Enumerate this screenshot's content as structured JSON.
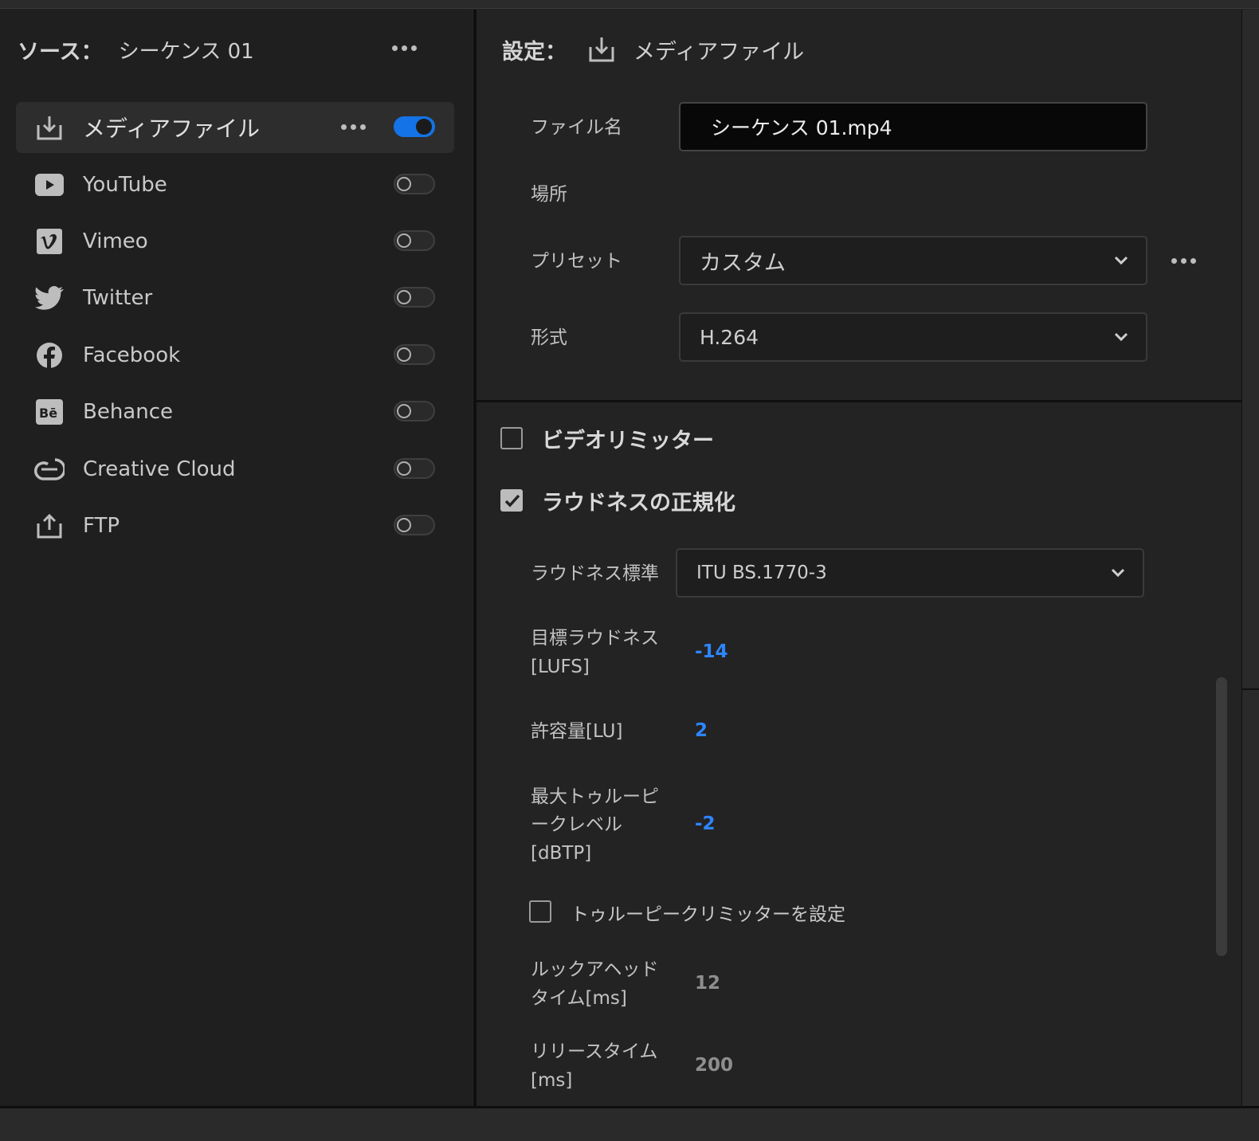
{
  "source": {
    "label": "ソース：",
    "sequence": "シーケンス 01"
  },
  "destinations": [
    {
      "label": "メディアファイル",
      "icon": "download-tray-icon",
      "active": true,
      "enabled": true
    },
    {
      "label": "YouTube",
      "icon": "youtube-icon",
      "active": false,
      "enabled": false
    },
    {
      "label": "Vimeo",
      "icon": "vimeo-icon",
      "active": false,
      "enabled": false
    },
    {
      "label": "Twitter",
      "icon": "twitter-icon",
      "active": false,
      "enabled": false
    },
    {
      "label": "Facebook",
      "icon": "facebook-icon",
      "active": false,
      "enabled": false
    },
    {
      "label": "Behance",
      "icon": "behance-icon",
      "active": false,
      "enabled": false
    },
    {
      "label": "Creative Cloud",
      "icon": "creative-cloud-icon",
      "active": false,
      "enabled": false
    },
    {
      "label": "FTP",
      "icon": "upload-tray-icon",
      "active": false,
      "enabled": false
    }
  ],
  "settings": {
    "label": "設定：",
    "target": "メディアファイル",
    "filename_label": "ファイル名",
    "filename_value": "シーケンス 01.mp4",
    "location_label": "場所",
    "preset_label": "プリセット",
    "preset_value": "カスタム",
    "format_label": "形式",
    "format_value": "H.264"
  },
  "video_limiter": {
    "label": "ビデオリミッター",
    "checked": false
  },
  "loudness": {
    "label": "ラウドネスの正規化",
    "checked": true,
    "standard_label": "ラウドネス標準",
    "standard_value": "ITU BS.1770-3",
    "target_label_1": "目標ラウドネス",
    "target_label_2": "[LUFS]",
    "target_value": "-14",
    "tolerance_label": "許容量[LU]",
    "tolerance_value": "2",
    "max_peak_label_1": "最大トゥルーピ",
    "max_peak_label_2": "ークレベル",
    "max_peak_label_3": "[dBTP]",
    "max_peak_value": "-2",
    "true_peak_limiter_label": "トゥルーピークリミッターを設定",
    "true_peak_limiter_checked": false,
    "lookahead_label_1": "ルックアヘッド",
    "lookahead_label_2": "タイム[ms]",
    "lookahead_value": "12",
    "release_label_1": "リリースタイム",
    "release_label_2": "[ms]",
    "release_value": "200"
  },
  "colors": {
    "accent": "#1473e6",
    "value_blue": "#2d86ff",
    "panel_bg": "#1f1f1f",
    "field_bg": "#080808"
  }
}
